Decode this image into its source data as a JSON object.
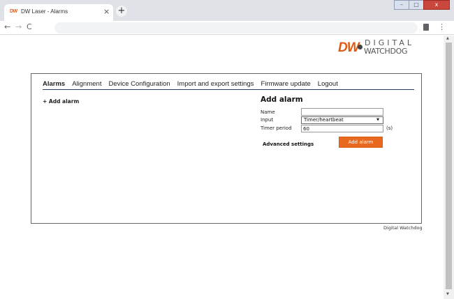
{
  "browser": {
    "tab_favicon": "DW",
    "tab_title": "DW Laser - Alarms",
    "tab_close": "×",
    "new_tab": "+",
    "back": "←",
    "forward": "→",
    "reload": "C",
    "menu": "⋮",
    "window_minimize": "–",
    "window_maximize": "□",
    "window_close": "x"
  },
  "logo": {
    "mark": "DW",
    "line1": "DIGITAL",
    "line2": "WATCHDOG",
    "brand_color": "#e35a15"
  },
  "nav": {
    "items": [
      {
        "label": "Alarms",
        "active": true
      },
      {
        "label": "Alignment",
        "active": false
      },
      {
        "label": "Device Configuration",
        "active": false
      },
      {
        "label": "Import and export settings",
        "active": false
      },
      {
        "label": "Firmware update",
        "active": false
      },
      {
        "label": "Logout",
        "active": false
      }
    ]
  },
  "alarms": {
    "add_link": "+ Add alarm"
  },
  "form": {
    "title": "Add alarm",
    "name_label": "Name",
    "name_value": "",
    "input_label": "Input",
    "input_value": "Timer/heartbeat",
    "timer_label": "Timer period",
    "timer_value": "60",
    "timer_unit": "(s)",
    "advanced_label": "Advanced settings",
    "submit_label": "Add alarm",
    "accent_color": "#e8691e"
  },
  "footer": {
    "text": "Digital Watchdog"
  }
}
